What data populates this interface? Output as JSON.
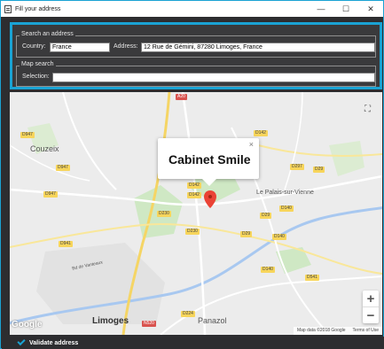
{
  "window": {
    "title": "Fill your address",
    "controls": {
      "minimize": "—",
      "maximize": "☐",
      "close": "✕"
    }
  },
  "search": {
    "group_title": "Search an address",
    "country_label": "Country:",
    "country_value": "France",
    "address_label": "Address:",
    "address_value": "12 Rue de Gémini, 87280 Limoges, France"
  },
  "map_search": {
    "group_title": "Map search",
    "selection_label": "Selection:",
    "selection_value": ""
  },
  "map": {
    "info_title": "Cabinet Smile",
    "close_glyph": "×",
    "places": {
      "couzeix": "Couzeix",
      "limoges": "Limoges",
      "palais": "Le Palais-sur-Vienne",
      "panazol": "Panazol",
      "bd_vanteaux": "Bd de Vanteaux"
    },
    "roads": {
      "a20_top": "A20",
      "d947a": "D947",
      "d947b": "D947",
      "d947c": "D947",
      "d142a": "D142",
      "d142b": "D142",
      "d142c": "D142",
      "d297": "D297",
      "d29a": "D29",
      "d29b": "D29",
      "d29c": "D29",
      "d140a": "D140",
      "d140b": "D140",
      "d140c": "D140",
      "d230a": "D230",
      "d230b": "D230",
      "d941": "D941",
      "d224": "D224",
      "d541": "D541",
      "n520": "N520"
    },
    "zoom_in": "+",
    "zoom_out": "−",
    "fullscreen_glyph": "⛶",
    "google_logo": "Google",
    "footer_data": "Map data ©2018 Google",
    "footer_terms": "Terms of Use",
    "colors": {
      "marker": "#ea4335",
      "water": "#a8c8f0",
      "park": "#cfe8c4"
    }
  },
  "actions": {
    "validate_label": "Validate address"
  }
}
